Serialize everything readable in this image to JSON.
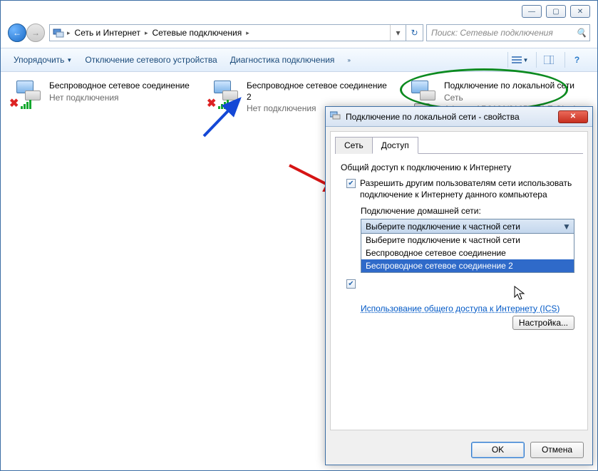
{
  "window_controls": {
    "min": "—",
    "max": "▢",
    "close": "✕"
  },
  "breadcrumb": {
    "root": "Сеть и Интернет",
    "current": "Сетевые подключения"
  },
  "search": {
    "placeholder": "Поиск: Сетевые подключения"
  },
  "toolbar": {
    "organize": "Упорядочить",
    "disable": "Отключение сетевого устройства",
    "diagnose": "Диагностика подключения"
  },
  "connections": [
    {
      "title": "Беспроводное сетевое соединение",
      "sub1": "Нет подключения",
      "sub2": "",
      "kind": "wifi"
    },
    {
      "title": "Беспроводное сетевое соединение 2",
      "sub1": "Нет подключения",
      "sub2": "",
      "kind": "wifi"
    },
    {
      "title": "Подключение по локальной сети",
      "sub1": "Сеть",
      "sub2": "Atheros AR8161/8165 PCI-E Gigab...",
      "kind": "lan"
    }
  ],
  "dialog": {
    "title": "Подключение по локальной сети - свойства",
    "tabs": {
      "network": "Сеть",
      "sharing": "Доступ"
    },
    "group_title": "Общий доступ к подключению к Интернету",
    "chk1": "Разрешить другим пользователям сети использовать подключение к Интернету данного компьютера",
    "home_label": "Подключение домашней сети:",
    "combo_selected": "Выберите подключение к частной сети",
    "combo_options": [
      "Выберите подключение к частной сети",
      "Беспроводное сетевое соединение",
      "Беспроводное сетевое соединение 2"
    ],
    "link": "Использование общего доступа к Интернету (ICS)",
    "settings_btn": "Настройка...",
    "ok": "OK",
    "cancel": "Отмена"
  }
}
